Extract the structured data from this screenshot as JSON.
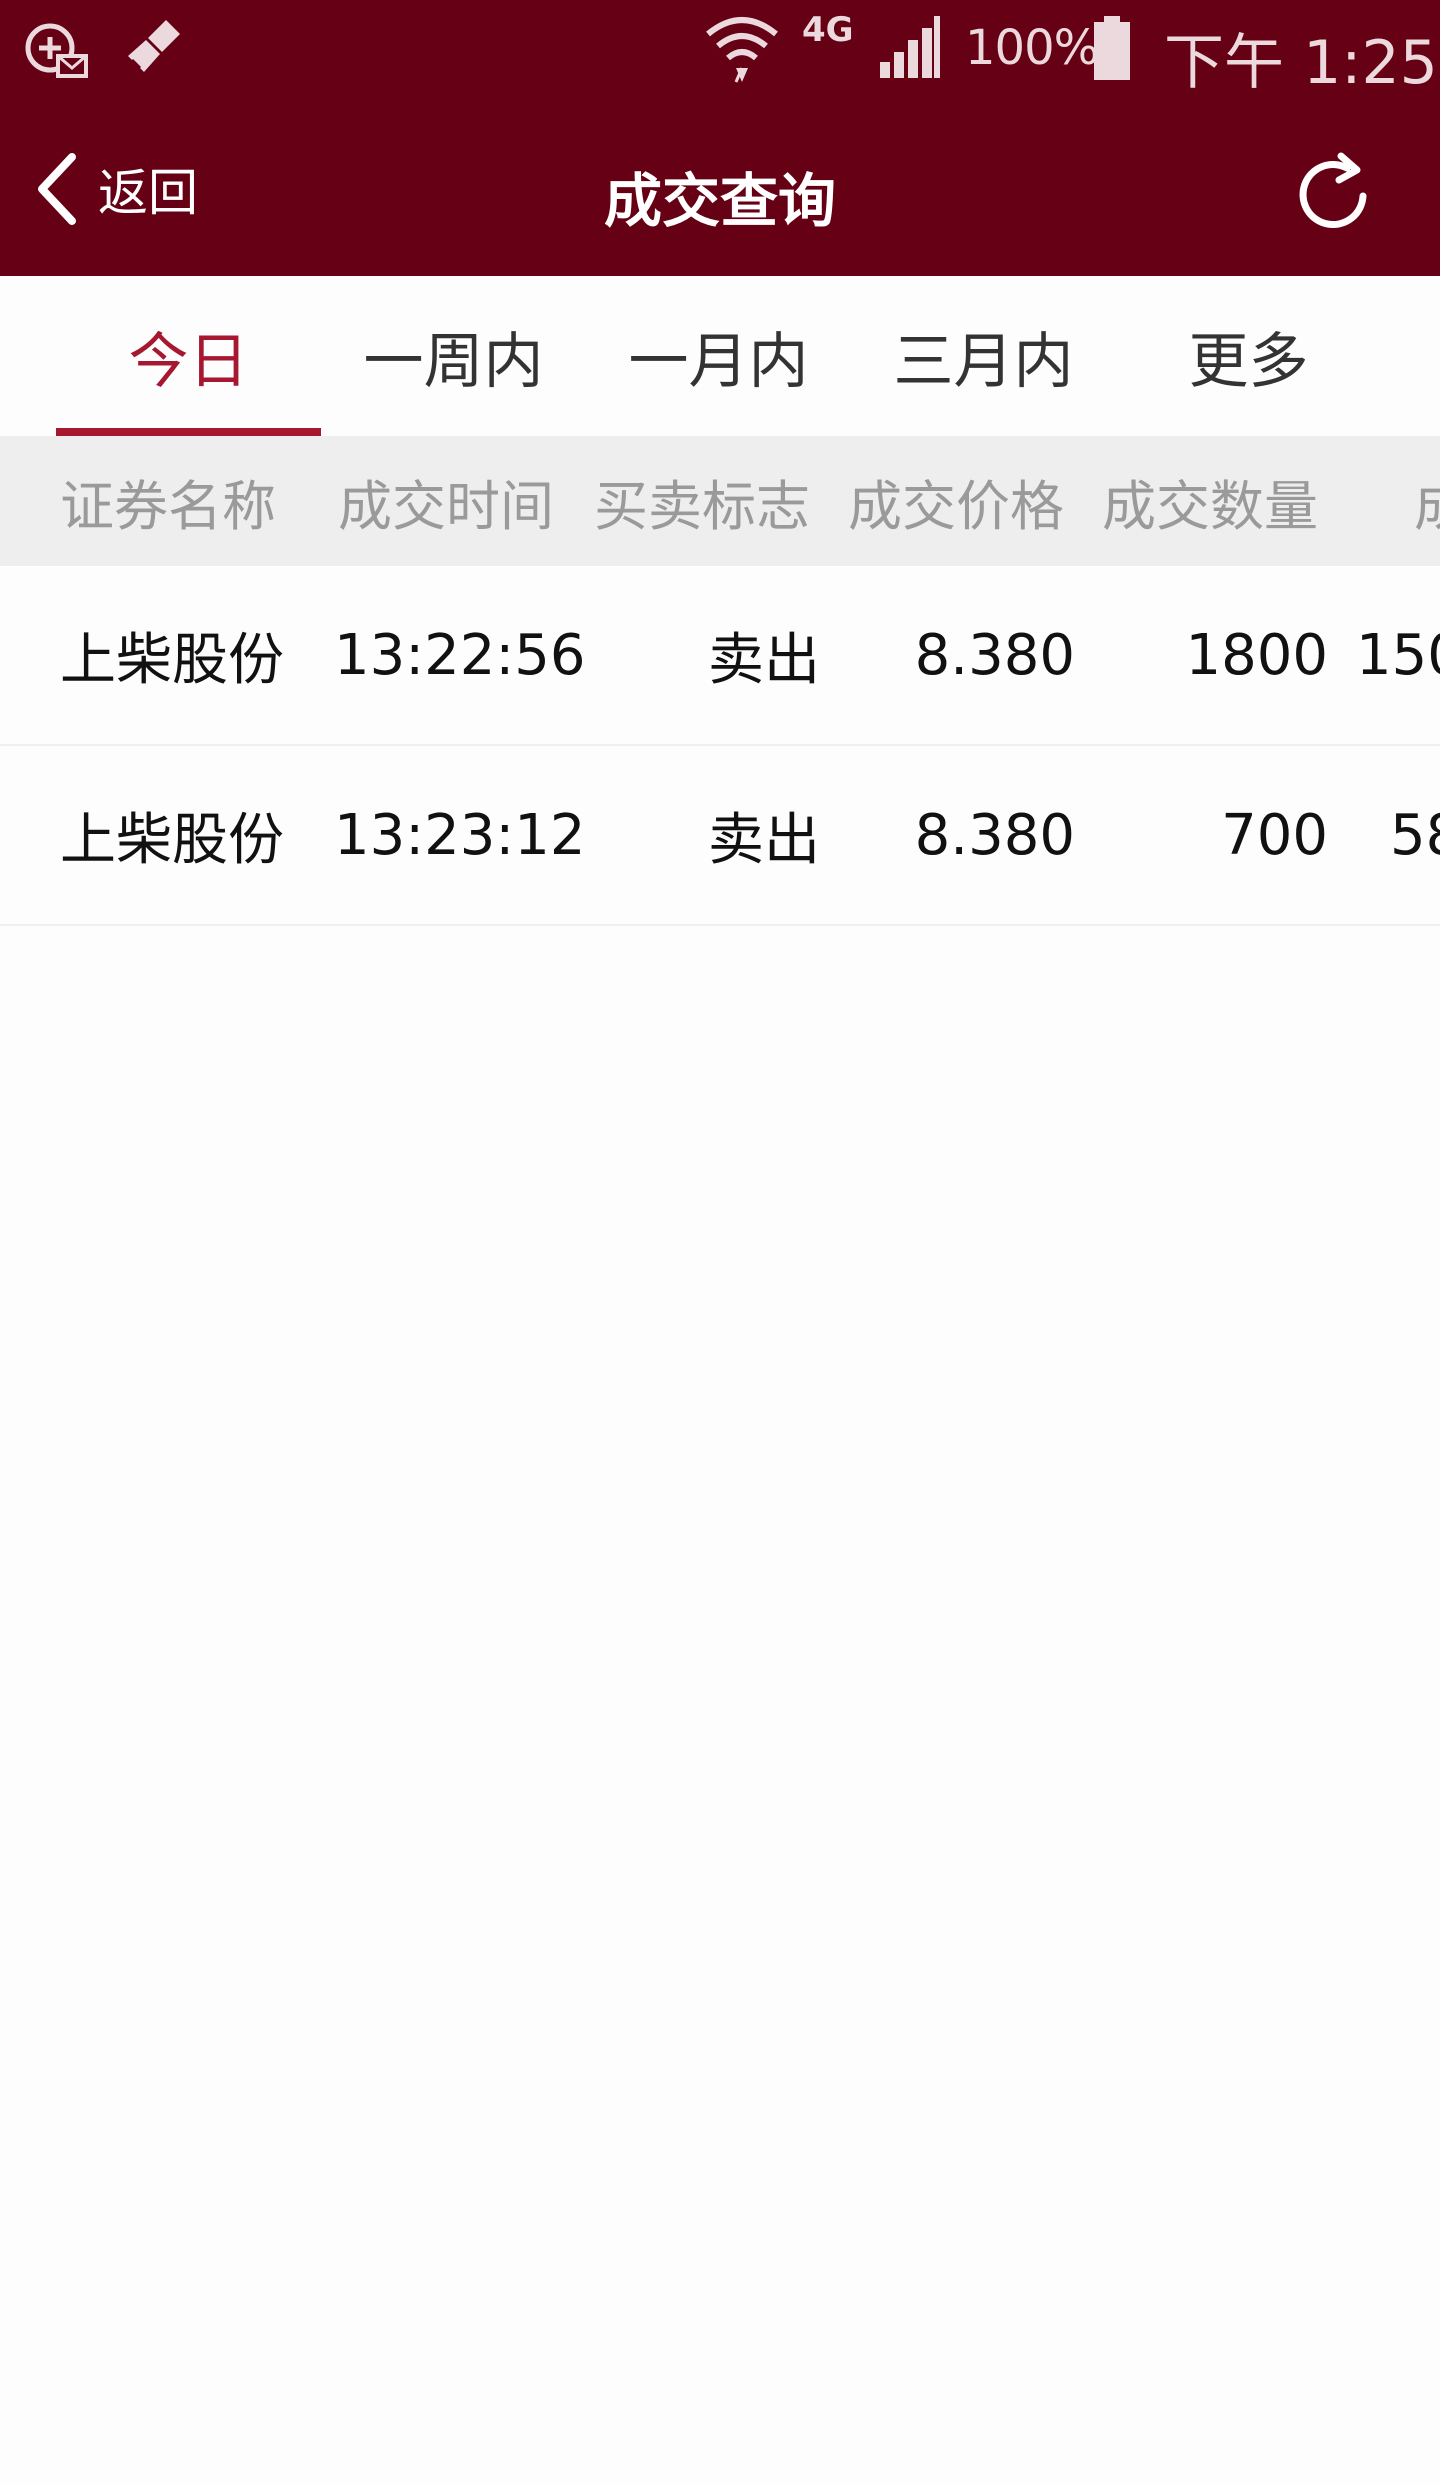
{
  "status_bar": {
    "network": "4G",
    "battery": "100%",
    "time": "下午 1:25"
  },
  "header": {
    "back_label": "返回",
    "title": "成交查询"
  },
  "tabs": [
    {
      "label": "今日",
      "active": true
    },
    {
      "label": "一周内",
      "active": false
    },
    {
      "label": "一月内",
      "active": false
    },
    {
      "label": "三月内",
      "active": false
    },
    {
      "label": "更多",
      "active": false
    }
  ],
  "table": {
    "columns": [
      "证券名称",
      "成交时间",
      "买卖标志",
      "成交价格",
      "成交数量",
      "成"
    ],
    "rows": [
      {
        "name": "上柴股份",
        "time": "13:22:56",
        "side": "卖出",
        "price": "8.380",
        "qty": "1800",
        "extra": "150"
      },
      {
        "name": "上柴股份",
        "time": "13:23:12",
        "side": "卖出",
        "price": "8.380",
        "qty": "700",
        "extra": "58"
      }
    ]
  },
  "colors": {
    "brand": "#660014",
    "accent": "#a6182f",
    "header_bg": "#eeeeee"
  },
  "icons": {
    "notification_1": "message-plus-icon",
    "notification_2": "broom-icon",
    "wifi": "wifi-icon",
    "signal": "signal-icon",
    "battery": "battery-icon",
    "back": "chevron-left-icon",
    "refresh": "refresh-icon"
  }
}
